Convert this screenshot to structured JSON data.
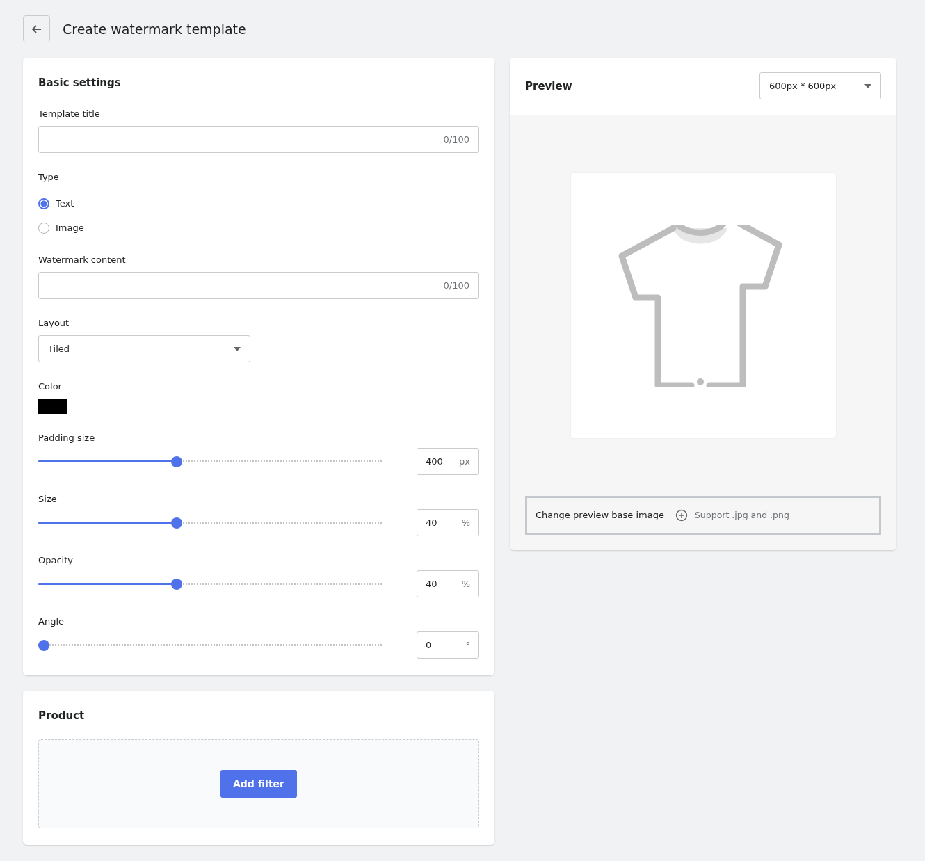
{
  "header": {
    "title": "Create watermark template"
  },
  "basic_settings": {
    "title": "Basic settings",
    "fields": [
      {
        "kind": "text",
        "label": "Template title",
        "counter": "0/100"
      },
      {
        "kind": "radio",
        "label": "Type",
        "options": [
          {
            "label": "Text",
            "selected": true
          },
          {
            "label": "Image",
            "selected": false
          }
        ]
      },
      {
        "kind": "text",
        "label": "Watermark content",
        "counter": "0/100"
      },
      {
        "kind": "select",
        "label": "Layout",
        "value": "Tiled"
      },
      {
        "kind": "color",
        "label": "Color",
        "color": "#000000"
      },
      {
        "kind": "slider",
        "label": "Padding size",
        "level": 0.4,
        "value": "400",
        "unit": "px"
      },
      {
        "kind": "slider",
        "label": "Size",
        "level": 0.4,
        "value": "40",
        "unit": "%"
      },
      {
        "kind": "slider",
        "label": "Opacity",
        "level": 0.4,
        "value": "40",
        "unit": "%"
      },
      {
        "kind": "slider",
        "label": "Angle",
        "level": 0,
        "value": "0",
        "unit": "°"
      }
    ]
  },
  "product": {
    "title": "Product",
    "button": "Add filter"
  },
  "preview": {
    "title": "Preview",
    "size_select": "600px * 600px",
    "change_label": "Change preview base image",
    "support_hint": "Support .jpg and .png"
  }
}
